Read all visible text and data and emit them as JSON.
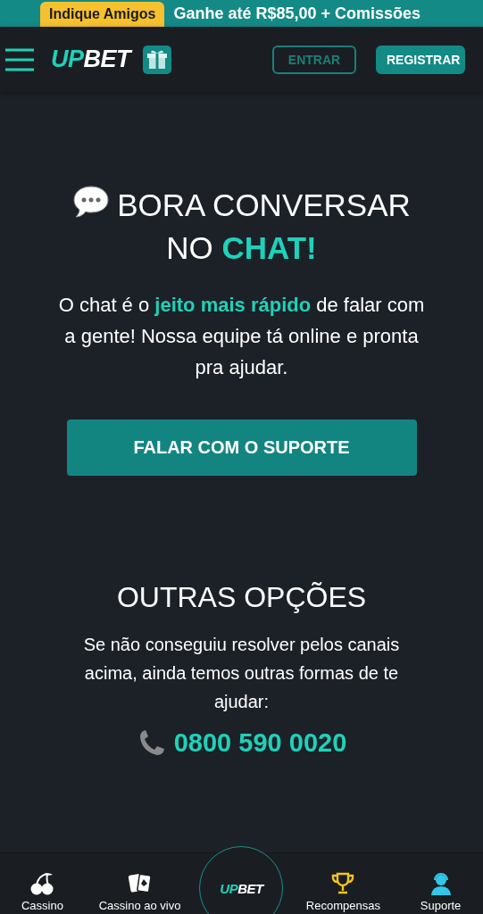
{
  "promo_banner": {
    "tag": "Indique Amigos",
    "text": "Ganhe até R$85,00 + Comissões"
  },
  "header": {
    "logo": {
      "accent": "UP",
      "rest": "BET"
    },
    "buttons": [
      {
        "kind": "outline",
        "label": "ENTRAR"
      },
      {
        "kind": "solid",
        "label": "REGISTRAR"
      }
    ]
  },
  "chat_section": {
    "title": "BORA CONVERSAR NO **CHAT!**",
    "text": "O chat é o **jeito mais rápido** de falar com a gente! Nossa equipe tá online e pronta pra ajudar.",
    "button": "FALAR COM O SUPORTE"
  },
  "other_options": {
    "title": "OUTRAS OPÇÕES",
    "text": "Se não conseguiu resolver pelos canais acima, ainda temos outras formas de te ajudar:",
    "phone": "0800 590 0020"
  },
  "bottom_nav": [
    {
      "kind": "item",
      "label": "Cassino"
    },
    {
      "kind": "item",
      "label": "Cassino ao vivo"
    },
    {
      "kind": "logo",
      "logo": {
        "accent": "UP",
        "rest": "BET"
      }
    },
    {
      "kind": "item",
      "label": "Recompensas"
    },
    {
      "kind": "item",
      "label": "Suporte"
    }
  ]
}
